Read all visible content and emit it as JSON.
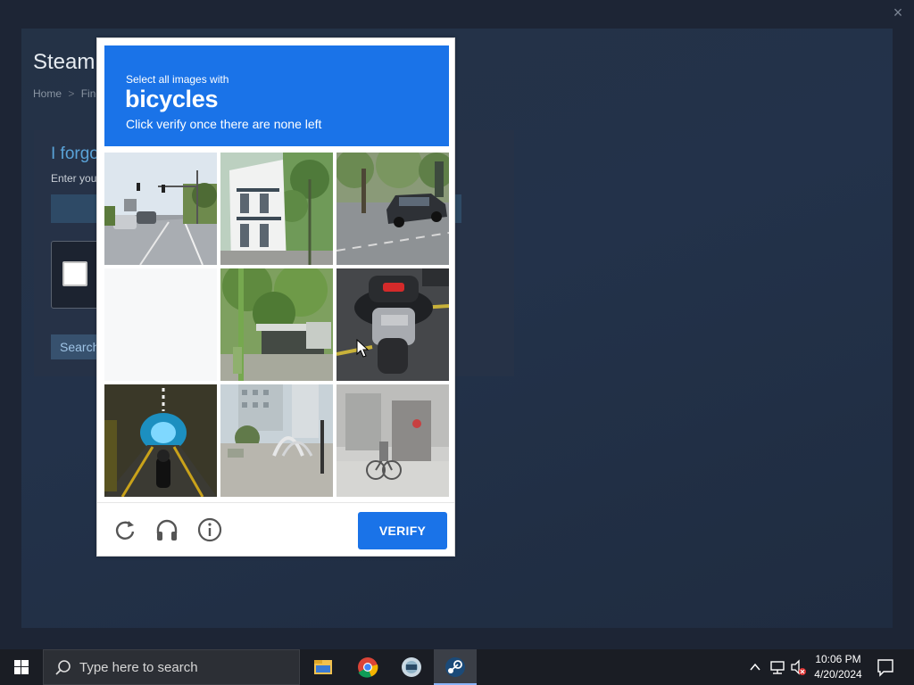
{
  "steam_page": {
    "title": "Steam",
    "breadcrumb_home": "Home",
    "breadcrumb_sep": ">",
    "breadcrumb_next": "Find",
    "heading": "I forgo",
    "subtext": "Enter you",
    "search_label": "Search",
    "close_icon": "×"
  },
  "captcha": {
    "line1": "Select all images with",
    "keyword": "bicycles",
    "line2": "Click verify once there are none left",
    "verify_label": "VERIFY",
    "brand_color": "#1a73e8",
    "tiles": [
      {
        "id": 1,
        "scene": "street with traffic lights and cars"
      },
      {
        "id": 2,
        "scene": "white building with balconies"
      },
      {
        "id": 3,
        "scene": "parked black car under trees"
      },
      {
        "id": 4,
        "scene": "blank tile"
      },
      {
        "id": 5,
        "scene": "trees and shelter by path"
      },
      {
        "id": 6,
        "scene": "rear of scooter on road"
      },
      {
        "id": 7,
        "scene": "tunnel with lights and motorcycle"
      },
      {
        "id": 8,
        "scene": "plaza with arch sculpture and tall building"
      },
      {
        "id": 9,
        "scene": "bicycle near storefront"
      }
    ],
    "footer_icons": [
      "refresh-icon",
      "headphones-icon",
      "info-icon"
    ]
  },
  "taskbar": {
    "search_placeholder": "Type here to search",
    "apps": [
      "file-explorer-icon",
      "chrome-icon",
      "app-icon",
      "steam-icon"
    ],
    "time": "10:06 PM",
    "date": "4/20/2024"
  }
}
